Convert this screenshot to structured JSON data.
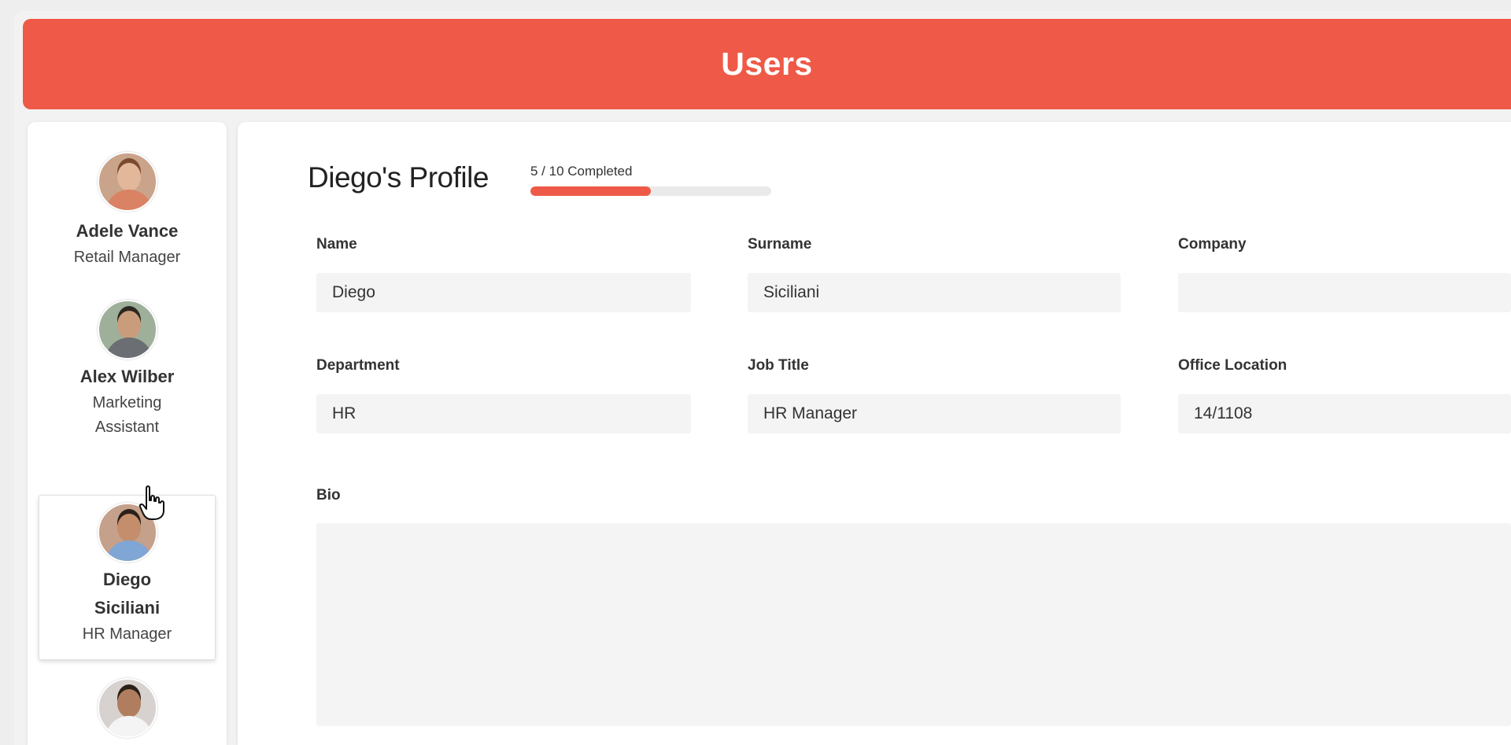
{
  "header": {
    "title": "Users",
    "bg_color": "#ee5a47"
  },
  "users": [
    {
      "name": "Adele Vance",
      "role": "Retail Manager",
      "avatar_colors": {
        "bg": "#c9a48a",
        "skin": "#e3b79a",
        "hair": "#7a4a2e",
        "shirt": "#d98264"
      }
    },
    {
      "name": "Alex Wilber",
      "role": "Marketing Assistant",
      "avatar_colors": {
        "bg": "#9fb09a",
        "skin": "#c99c7c",
        "hair": "#2e2620",
        "shirt": "#6b6e73"
      }
    },
    {
      "name": "Diego Siciliani",
      "role": "HR Manager",
      "selected": true,
      "avatar_colors": {
        "bg": "#c5a08a",
        "skin": "#c48e6c",
        "hair": "#2a2019",
        "shirt": "#7fa6d4"
      }
    },
    {
      "name": "",
      "role": "",
      "avatar_colors": {
        "bg": "#d7d2cf",
        "skin": "#b07e5e",
        "hair": "#2b2118",
        "shirt": "#f4f4f4"
      }
    }
  ],
  "profile": {
    "title": "Diego's Profile",
    "progress_text": "5 / 10  Completed",
    "progress_completed": 5,
    "progress_total": 10,
    "accent_color": "#ee5a47"
  },
  "fields": {
    "name": {
      "label": "Name",
      "value": "Diego"
    },
    "surname": {
      "label": "Surname",
      "value": "Siciliani"
    },
    "company": {
      "label": "Company",
      "value": ""
    },
    "department": {
      "label": "Department",
      "value": "HR"
    },
    "job_title": {
      "label": "Job Title",
      "value": "HR Manager"
    },
    "office_location": {
      "label": "Office Location",
      "value": "14/1108"
    },
    "bio": {
      "label": "Bio",
      "value": ""
    }
  },
  "icons": {
    "cursor": "hand-pointer-icon"
  }
}
